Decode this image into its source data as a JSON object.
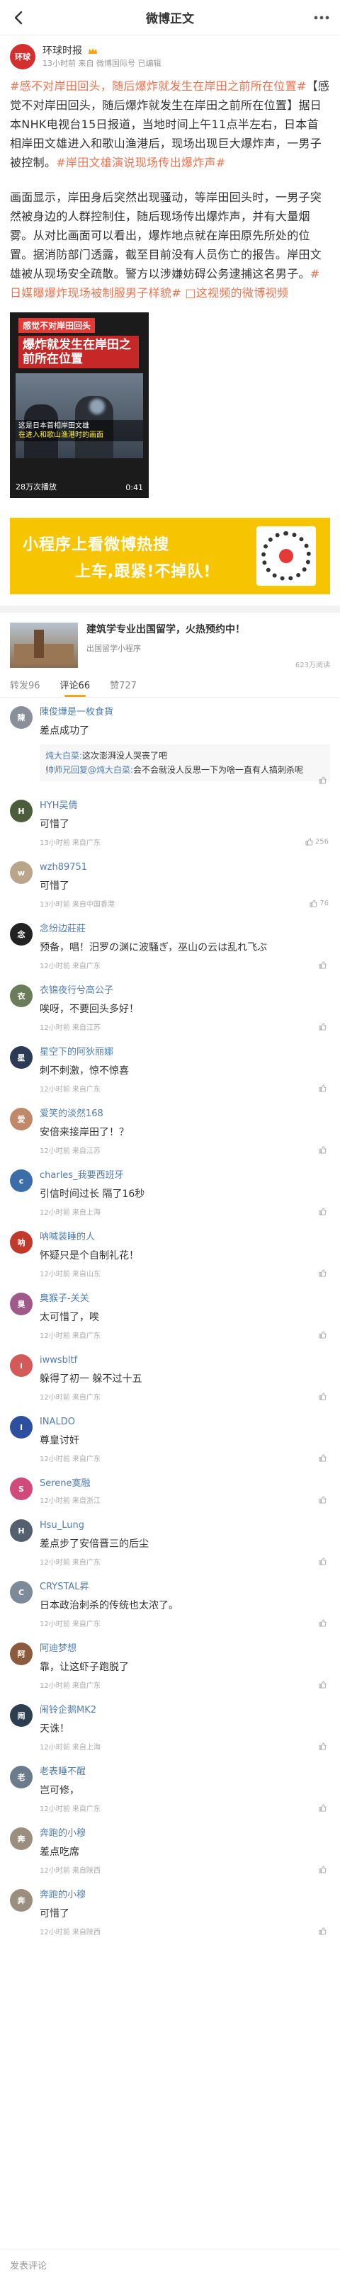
{
  "topbar": {
    "title": "微博正文"
  },
  "post": {
    "author": "环球时报",
    "avatar_text": "环球",
    "meta": "13小时前 来自 微博国际号 已编辑",
    "hashtag1": "#感不对岸田回头，随后爆炸就发生在岸田之前所在位置#",
    "body1": "【感觉不对岸田回头，随后爆炸就发生在岸田之前所在位置】据日本NHK电视台15日报道，当地时间上午11点半左右，日本首相岸田文雄进入和歌山渔港后，现场出现巨大爆炸声，一男子被控制。",
    "hashtag2": "#岸田文雄演说现场传出爆炸声#",
    "body2": "画面显示，岸田身后突然出现骚动，等岸田回头时，一男子突然被身边的人群控制住，随后现场传出爆炸声，并有大量烟雾。从对比画面可以看出，爆炸地点就在岸田原先所处的位置。据消防部门透露，截至目前没有人员伤亡的报告。岸田文雄被从现场安全疏散。警方以涉嫌妨碍公务逮捕这名男子。",
    "hashtag3": "#日媒曝爆炸现场被制服男子样貌#",
    "video_link": "这视频的微博视频"
  },
  "video": {
    "banner1": "感觉不对岸田回头",
    "banner2": "爆炸就发生在岸田之前所在位置",
    "caption1": "这是日本首相岸田文雄",
    "caption2": "在进入和歌山渔港时的画面",
    "plays": "28万次播放",
    "duration": "0:41"
  },
  "ad": {
    "line1": "小程序上看微博热搜",
    "line2": "上车,跟紧!不掉队!"
  },
  "card": {
    "title": "建筑学专业出国留学，火热预约中！",
    "subtitle": "出国留学小程序",
    "reads": "623万阅读"
  },
  "tabs": [
    {
      "label": "转发96"
    },
    {
      "label": "评论66"
    },
    {
      "label": "赞727"
    }
  ],
  "comments": [
    {
      "name": "陳俊燁是一枚食貨",
      "text": "差点成功了",
      "meta": "",
      "likes": "",
      "avatar_color": "#8a8f9a",
      "avatar_text": "陳",
      "replies": [
        {
          "name": "炖大白菜:",
          "text": "这次澎湃没人哭丧了吧"
        },
        {
          "name": "帅师兄回复@炖大白菜:",
          "text": "会不会就没人反思一下为啥一直有人搞刺杀呢"
        }
      ]
    },
    {
      "name": "HYH吴倩",
      "text": "可惜了",
      "meta": "13小时前 来自广东",
      "likes": "256",
      "avatar_color": "#4b5d3a",
      "avatar_text": "H",
      "replies": []
    },
    {
      "name": "wzh89751",
      "text": "可惜了",
      "meta": "13小时前 来自中国香港",
      "likes": "76",
      "avatar_color": "#b9a58a",
      "avatar_text": "w",
      "replies": []
    },
    {
      "name": "念纷边莊莊",
      "text": "预备，唱！汨罗の渊に波騒ぎ，巫山の云は乱れ飞ぶ",
      "meta": "12小时前 来自广东",
      "likes": "",
      "avatar_color": "#222222",
      "avatar_text": "念",
      "replies": []
    },
    {
      "name": "衣锦夜行兮高公子",
      "text": "唉呀，不要回头多好！",
      "meta": "12小时前 来自江苏",
      "likes": "",
      "avatar_color": "#6a7c5a",
      "avatar_text": "衣",
      "replies": []
    },
    {
      "name": "星空下的阿狄丽娜",
      "text": "刺不刺激，惊不惊喜",
      "meta": "12小时前 来自广东",
      "likes": "",
      "avatar_color": "#2b3a55",
      "avatar_text": "星",
      "replies": []
    },
    {
      "name": "爱笑的淡然168",
      "text": "安倍来接岸田了！？",
      "meta": "12小时前 来自江苏",
      "likes": "",
      "avatar_color": "#c08a6a",
      "avatar_text": "爱",
      "replies": []
    },
    {
      "name": "charles_我要西班牙",
      "text": "引信时间过长 隔了16秒",
      "meta": "12小时前 来自上海",
      "likes": "",
      "avatar_color": "#3b6ea8",
      "avatar_text": "c",
      "replies": []
    },
    {
      "name": "呐喊装睡的人",
      "text": "怀疑只是个自制礼花！",
      "meta": "12小时前 来自山东",
      "likes": "",
      "avatar_color": "#c0392b",
      "avatar_text": "呐",
      "replies": []
    },
    {
      "name": "臭猴子-关关",
      "text": "太可惜了，唉",
      "meta": "12小时前 来自广东",
      "likes": "",
      "avatar_color": "#a05a8a",
      "avatar_text": "臭",
      "replies": []
    },
    {
      "name": "iwwsbltf",
      "text": "躲得了初一 躲不过十五",
      "meta": "12小时前 来自广东",
      "likes": "",
      "avatar_color": "#d45a5a",
      "avatar_text": "i",
      "replies": []
    },
    {
      "name": "INALDO",
      "text": "尊皇讨奸",
      "meta": "12小时前 来自广东",
      "likes": "",
      "avatar_color": "#2d4fa0",
      "avatar_text": "I",
      "replies": []
    },
    {
      "name": "Serene寞融",
      "text": "",
      "meta": "12小时前 来自浙江",
      "likes": "",
      "avatar_color": "#d14b7a",
      "avatar_text": "S",
      "replies": []
    },
    {
      "name": "Hsu_Lung",
      "text": "差点步了安倍晋三的后尘",
      "meta": "12小时前 来自广东",
      "likes": "",
      "avatar_color": "#55606e",
      "avatar_text": "H",
      "replies": []
    },
    {
      "name": "CRYSTAL昇",
      "text": "日本政治刺杀的传统也太浓了。",
      "meta": "12小时前 来自广东",
      "likes": "",
      "avatar_color": "#7d8a99",
      "avatar_text": "C",
      "replies": []
    },
    {
      "name": "阿迪梦想",
      "text": "靠，让这虾子跑脱了",
      "meta": "12小时前 来自广东",
      "likes": "",
      "avatar_color": "#8c5a3c",
      "avatar_text": "阿",
      "replies": []
    },
    {
      "name": "闹铃企鹅MK2",
      "text": "天诛！",
      "meta": "12小时前 来自上海",
      "likes": "",
      "avatar_color": "#2c3e50",
      "avatar_text": "闹",
      "replies": []
    },
    {
      "name": "老表睡不醒",
      "text": "岂可修，",
      "meta": "12小时前 来自广东",
      "likes": "",
      "avatar_color": "#6b7b8c",
      "avatar_text": "老",
      "replies": []
    },
    {
      "name": "奔跑的小穆",
      "text": "差点吃席",
      "meta": "12小时前 来自陕西",
      "likes": "",
      "avatar_color": "#9a8e7e",
      "avatar_text": "奔",
      "replies": []
    },
    {
      "name": "奔跑的小穆",
      "text": "可惜了",
      "meta": "12小时前 来自陕西",
      "likes": "",
      "avatar_color": "#9a8e7e",
      "avatar_text": "奔",
      "replies": []
    }
  ],
  "bottombar": {
    "placeholder": "发表评论"
  },
  "colors": {
    "accent": "#eb7350",
    "link": "#507daf",
    "tab_indicator": "#f7a21b",
    "ad_bg": "#f6c400"
  }
}
